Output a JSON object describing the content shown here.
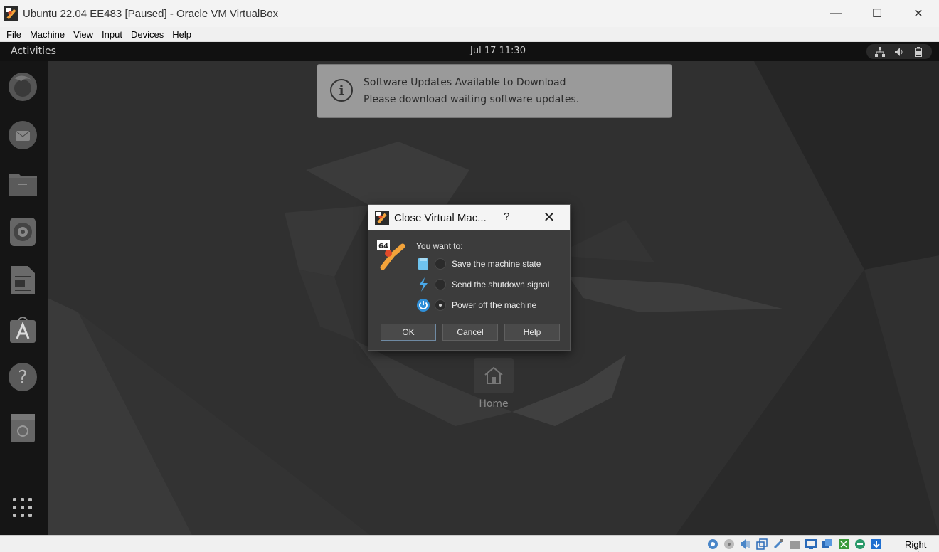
{
  "window": {
    "title": "Ubuntu 22.04 EE483 [Paused] - Oracle VM VirtualBox",
    "controls": {
      "minimize": "—",
      "maximize": "☐",
      "close": "✕"
    }
  },
  "menubar": {
    "items": [
      "File",
      "Machine",
      "View",
      "Input",
      "Devices",
      "Help"
    ]
  },
  "guest": {
    "topbar": {
      "activities": "Activities",
      "clock": "Jul 17  11:30",
      "tray_icons": [
        "network-icon",
        "volume-icon",
        "battery-icon"
      ]
    },
    "dock": {
      "items": [
        "firefox-icon",
        "thunderbird-icon",
        "files-icon",
        "rhythmbox-icon",
        "libreoffice-writer-icon",
        "app-center-icon",
        "help-icon",
        "trash-icon",
        "show-apps-icon"
      ]
    },
    "notification": {
      "title": "Software Updates Available to Download",
      "body": "Please download waiting software updates."
    },
    "desktop": {
      "home_label": "Home"
    }
  },
  "dialog": {
    "title": "Close Virtual Mac...",
    "help_glyph": "?",
    "close_glyph": "✕",
    "logo_badge": "64",
    "prompt": "You want to:",
    "options": [
      {
        "label": "Save the machine state",
        "icon": "save-state-icon",
        "checked": false
      },
      {
        "label": "Send the shutdown signal",
        "icon": "shutdown-signal-icon",
        "checked": false
      },
      {
        "label": "Power off the machine",
        "icon": "power-icon",
        "checked": true
      }
    ],
    "buttons": {
      "ok": "OK",
      "cancel": "Cancel",
      "help": "Help"
    }
  },
  "statusbar": {
    "host_key": "Right Ctrl",
    "icons": [
      "hard-disk-icon",
      "optical-drive-icon",
      "audio-icon",
      "network-icon",
      "usb-icon",
      "shared-folders-icon",
      "display-icon",
      "recording-icon",
      "mouse-integration-icon",
      "cpu-icon",
      "keyboard-icon"
    ]
  },
  "colors": {
    "accent": "#f3a33a",
    "dialog_bg": "#3c3c3c",
    "notification_bg": "#9a9a9a"
  }
}
